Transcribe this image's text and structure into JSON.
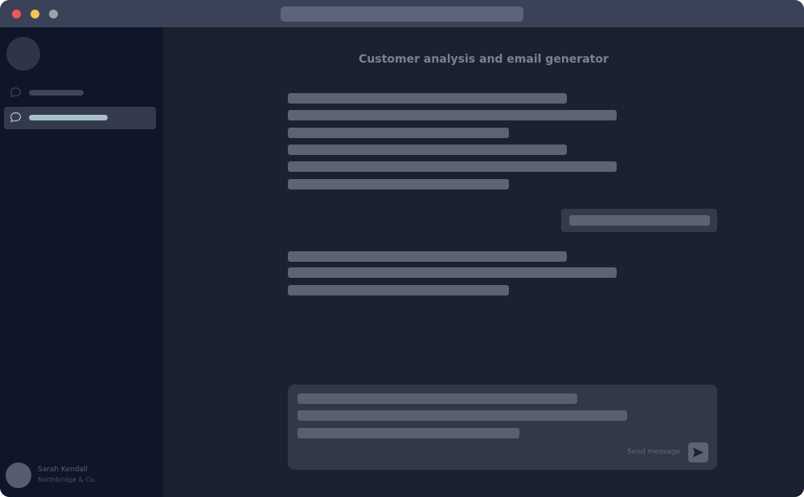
{
  "window": {
    "controls": [
      "close",
      "minimize",
      "maximize"
    ],
    "colors": {
      "close": "#f0555a",
      "minimize": "#f2c94c",
      "maximize": "#9aa3a8"
    }
  },
  "sidebar": {
    "items": [
      {
        "icon": "chat-bubble-icon",
        "selected": false
      },
      {
        "icon": "chat-bubble-icon",
        "selected": true
      }
    ],
    "user": {
      "name": "Sarah Kendall",
      "organization": "Northbridge & Co."
    }
  },
  "main": {
    "title": "Customer analysis and email generator",
    "composer": {
      "send_label": "Send message",
      "send_icon": "send-arrow-icon"
    }
  },
  "colors": {
    "background": "#1c2130",
    "sidebar": "#10162a",
    "titlebar": "#3a4258",
    "selected_item_accent": "#a9c0c4"
  }
}
